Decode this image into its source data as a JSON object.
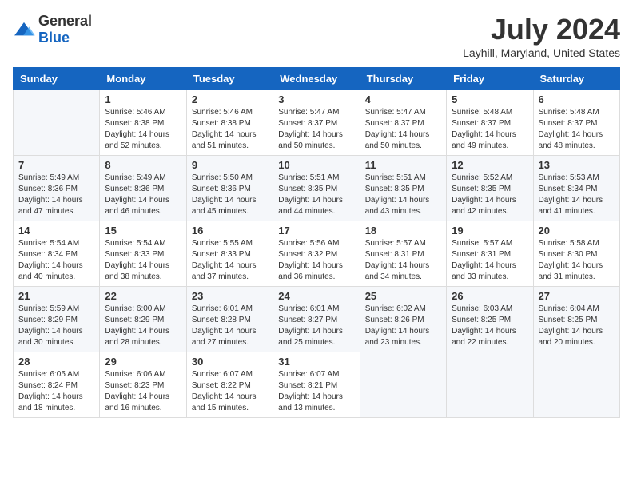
{
  "header": {
    "logo": {
      "general": "General",
      "blue": "Blue"
    },
    "title": "July 2024",
    "location": "Layhill, Maryland, United States"
  },
  "calendar": {
    "days_of_week": [
      "Sunday",
      "Monday",
      "Tuesday",
      "Wednesday",
      "Thursday",
      "Friday",
      "Saturday"
    ],
    "weeks": [
      [
        {
          "day": "",
          "info": ""
        },
        {
          "day": "1",
          "info": "Sunrise: 5:46 AM\nSunset: 8:38 PM\nDaylight: 14 hours\nand 52 minutes."
        },
        {
          "day": "2",
          "info": "Sunrise: 5:46 AM\nSunset: 8:38 PM\nDaylight: 14 hours\nand 51 minutes."
        },
        {
          "day": "3",
          "info": "Sunrise: 5:47 AM\nSunset: 8:37 PM\nDaylight: 14 hours\nand 50 minutes."
        },
        {
          "day": "4",
          "info": "Sunrise: 5:47 AM\nSunset: 8:37 PM\nDaylight: 14 hours\nand 50 minutes."
        },
        {
          "day": "5",
          "info": "Sunrise: 5:48 AM\nSunset: 8:37 PM\nDaylight: 14 hours\nand 49 minutes."
        },
        {
          "day": "6",
          "info": "Sunrise: 5:48 AM\nSunset: 8:37 PM\nDaylight: 14 hours\nand 48 minutes."
        }
      ],
      [
        {
          "day": "7",
          "info": "Sunrise: 5:49 AM\nSunset: 8:36 PM\nDaylight: 14 hours\nand 47 minutes."
        },
        {
          "day": "8",
          "info": "Sunrise: 5:49 AM\nSunset: 8:36 PM\nDaylight: 14 hours\nand 46 minutes."
        },
        {
          "day": "9",
          "info": "Sunrise: 5:50 AM\nSunset: 8:36 PM\nDaylight: 14 hours\nand 45 minutes."
        },
        {
          "day": "10",
          "info": "Sunrise: 5:51 AM\nSunset: 8:35 PM\nDaylight: 14 hours\nand 44 minutes."
        },
        {
          "day": "11",
          "info": "Sunrise: 5:51 AM\nSunset: 8:35 PM\nDaylight: 14 hours\nand 43 minutes."
        },
        {
          "day": "12",
          "info": "Sunrise: 5:52 AM\nSunset: 8:35 PM\nDaylight: 14 hours\nand 42 minutes."
        },
        {
          "day": "13",
          "info": "Sunrise: 5:53 AM\nSunset: 8:34 PM\nDaylight: 14 hours\nand 41 minutes."
        }
      ],
      [
        {
          "day": "14",
          "info": "Sunrise: 5:54 AM\nSunset: 8:34 PM\nDaylight: 14 hours\nand 40 minutes."
        },
        {
          "day": "15",
          "info": "Sunrise: 5:54 AM\nSunset: 8:33 PM\nDaylight: 14 hours\nand 38 minutes."
        },
        {
          "day": "16",
          "info": "Sunrise: 5:55 AM\nSunset: 8:33 PM\nDaylight: 14 hours\nand 37 minutes."
        },
        {
          "day": "17",
          "info": "Sunrise: 5:56 AM\nSunset: 8:32 PM\nDaylight: 14 hours\nand 36 minutes."
        },
        {
          "day": "18",
          "info": "Sunrise: 5:57 AM\nSunset: 8:31 PM\nDaylight: 14 hours\nand 34 minutes."
        },
        {
          "day": "19",
          "info": "Sunrise: 5:57 AM\nSunset: 8:31 PM\nDaylight: 14 hours\nand 33 minutes."
        },
        {
          "day": "20",
          "info": "Sunrise: 5:58 AM\nSunset: 8:30 PM\nDaylight: 14 hours\nand 31 minutes."
        }
      ],
      [
        {
          "day": "21",
          "info": "Sunrise: 5:59 AM\nSunset: 8:29 PM\nDaylight: 14 hours\nand 30 minutes."
        },
        {
          "day": "22",
          "info": "Sunrise: 6:00 AM\nSunset: 8:29 PM\nDaylight: 14 hours\nand 28 minutes."
        },
        {
          "day": "23",
          "info": "Sunrise: 6:01 AM\nSunset: 8:28 PM\nDaylight: 14 hours\nand 27 minutes."
        },
        {
          "day": "24",
          "info": "Sunrise: 6:01 AM\nSunset: 8:27 PM\nDaylight: 14 hours\nand 25 minutes."
        },
        {
          "day": "25",
          "info": "Sunrise: 6:02 AM\nSunset: 8:26 PM\nDaylight: 14 hours\nand 23 minutes."
        },
        {
          "day": "26",
          "info": "Sunrise: 6:03 AM\nSunset: 8:25 PM\nDaylight: 14 hours\nand 22 minutes."
        },
        {
          "day": "27",
          "info": "Sunrise: 6:04 AM\nSunset: 8:25 PM\nDaylight: 14 hours\nand 20 minutes."
        }
      ],
      [
        {
          "day": "28",
          "info": "Sunrise: 6:05 AM\nSunset: 8:24 PM\nDaylight: 14 hours\nand 18 minutes."
        },
        {
          "day": "29",
          "info": "Sunrise: 6:06 AM\nSunset: 8:23 PM\nDaylight: 14 hours\nand 16 minutes."
        },
        {
          "day": "30",
          "info": "Sunrise: 6:07 AM\nSunset: 8:22 PM\nDaylight: 14 hours\nand 15 minutes."
        },
        {
          "day": "31",
          "info": "Sunrise: 6:07 AM\nSunset: 8:21 PM\nDaylight: 14 hours\nand 13 minutes."
        },
        {
          "day": "",
          "info": ""
        },
        {
          "day": "",
          "info": ""
        },
        {
          "day": "",
          "info": ""
        }
      ]
    ]
  }
}
